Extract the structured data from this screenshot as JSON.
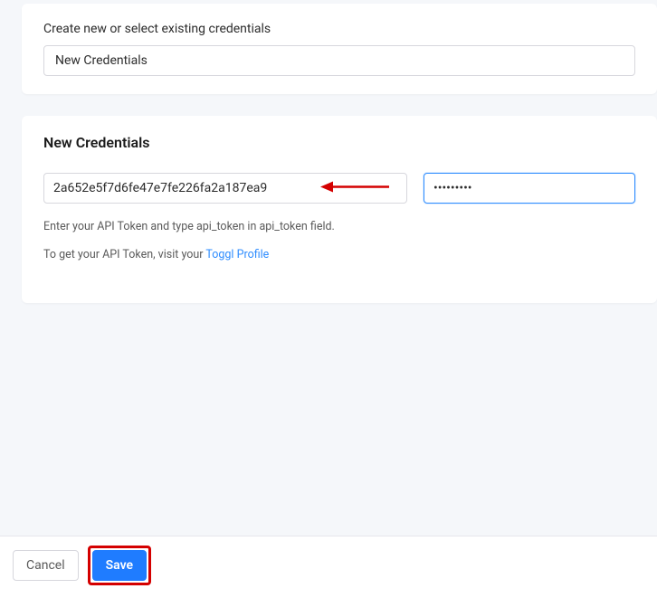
{
  "selector": {
    "label": "Create new or select existing credentials",
    "value": "New Credentials"
  },
  "section": {
    "title": "New Credentials",
    "token_value": "2a652e5f7d6fe47e7fe226fa2a187ea9",
    "password_value": "•••••••••",
    "helper1": "Enter your API Token and type api_token in api_token field.",
    "helper2_prefix": "To get your API Token, visit your ",
    "helper2_link": "Toggl Profile"
  },
  "footer": {
    "cancel": "Cancel",
    "save": "Save"
  },
  "colors": {
    "accent": "#1f7cff",
    "annotation": "#d40000"
  }
}
